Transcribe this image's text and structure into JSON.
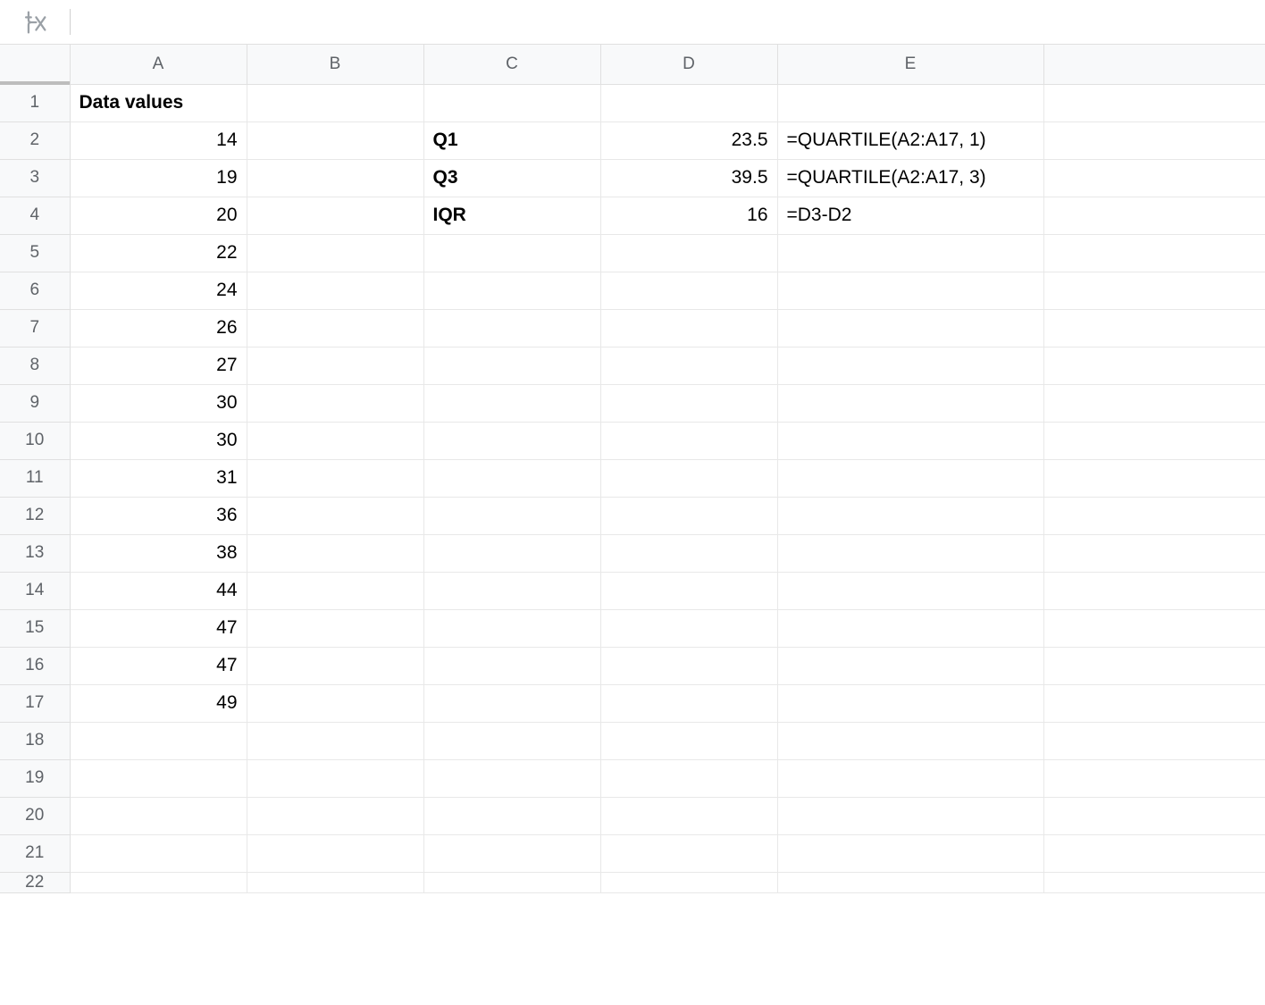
{
  "formulaBar": {
    "value": ""
  },
  "columns": [
    "A",
    "B",
    "C",
    "D",
    "E"
  ],
  "rowCount": 21,
  "lastPartialRow": "22",
  "cells": {
    "A1": {
      "v": "Data values",
      "bold": true,
      "align": "left"
    },
    "A2": {
      "v": "14",
      "align": "right"
    },
    "A3": {
      "v": "19",
      "align": "right"
    },
    "A4": {
      "v": "20",
      "align": "right"
    },
    "A5": {
      "v": "22",
      "align": "right"
    },
    "A6": {
      "v": "24",
      "align": "right"
    },
    "A7": {
      "v": "26",
      "align": "right"
    },
    "A8": {
      "v": "27",
      "align": "right"
    },
    "A9": {
      "v": "30",
      "align": "right"
    },
    "A10": {
      "v": "30",
      "align": "right"
    },
    "A11": {
      "v": "31",
      "align": "right"
    },
    "A12": {
      "v": "36",
      "align": "right"
    },
    "A13": {
      "v": "38",
      "align": "right"
    },
    "A14": {
      "v": "44",
      "align": "right"
    },
    "A15": {
      "v": "47",
      "align": "right"
    },
    "A16": {
      "v": "47",
      "align": "right"
    },
    "A17": {
      "v": "49",
      "align": "right"
    },
    "C2": {
      "v": "Q1",
      "bold": true,
      "align": "left"
    },
    "C3": {
      "v": "Q3",
      "bold": true,
      "align": "left"
    },
    "C4": {
      "v": "IQR",
      "bold": true,
      "align": "left"
    },
    "D2": {
      "v": "23.5",
      "align": "right"
    },
    "D3": {
      "v": "39.5",
      "align": "right"
    },
    "D4": {
      "v": "16",
      "align": "right"
    },
    "E2": {
      "v": "=QUARTILE(A2:A17, 1)",
      "align": "left"
    },
    "E3": {
      "v": "=QUARTILE(A2:A17, 3)",
      "align": "left"
    },
    "E4": {
      "v": "=D3-D2",
      "align": "left"
    }
  }
}
